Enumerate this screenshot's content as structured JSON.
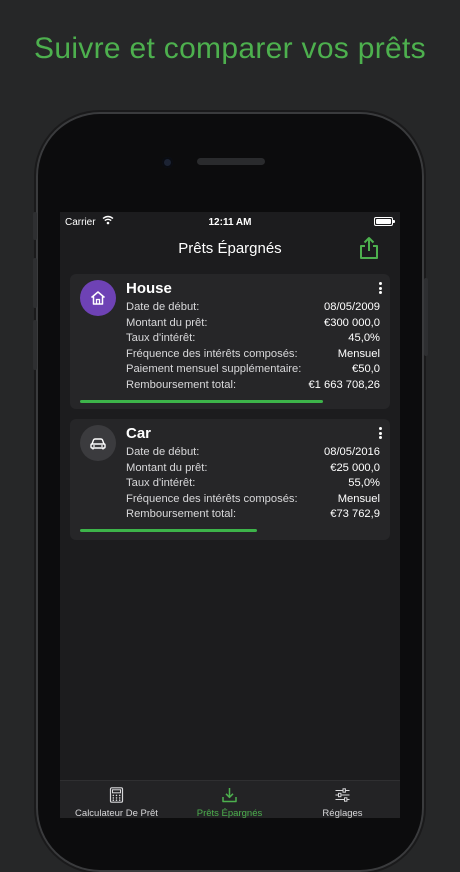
{
  "headline": "Suivre et comparer vos prêts",
  "status_bar": {
    "carrier": "Carrier",
    "time": "12:11 AM"
  },
  "navbar": {
    "title": "Prêts Épargnés"
  },
  "colors": {
    "accent": "#4db04e",
    "progress": "#3db44a",
    "house_avatar": "#6e42b5"
  },
  "loans": [
    {
      "name": "House",
      "icon": "house-icon",
      "rows": [
        {
          "label": "Date de début:",
          "value": "08/05/2009"
        },
        {
          "label": "Montant du prêt:",
          "value": "€300 000,0"
        },
        {
          "label": "Taux d'intérêt:",
          "value": "45,0%"
        },
        {
          "label": "Fréquence des intérêts composés:",
          "value": "Mensuel"
        },
        {
          "label": "Paiement mensuel supplémentaire:",
          "value": "€50,0"
        },
        {
          "label": "Remboursement total:",
          "value": "€1 663 708,26"
        }
      ],
      "progress": 0.81
    },
    {
      "name": "Car",
      "icon": "car-icon",
      "rows": [
        {
          "label": "Date de début:",
          "value": "08/05/2016"
        },
        {
          "label": "Montant du prêt:",
          "value": "€25 000,0"
        },
        {
          "label": "Taux d'intérêt:",
          "value": "55,0%"
        },
        {
          "label": "Fréquence des intérêts composés:",
          "value": "Mensuel"
        },
        {
          "label": "Remboursement total:",
          "value": "€73 762,9"
        }
      ],
      "progress": 0.59
    }
  ],
  "tabs": [
    {
      "label": "Calculateur De Prêt",
      "icon": "calculator-icon",
      "active": false
    },
    {
      "label": "Prêts Épargnés",
      "icon": "download-icon",
      "active": true
    },
    {
      "label": "Réglages",
      "icon": "sliders-icon",
      "active": false
    }
  ]
}
